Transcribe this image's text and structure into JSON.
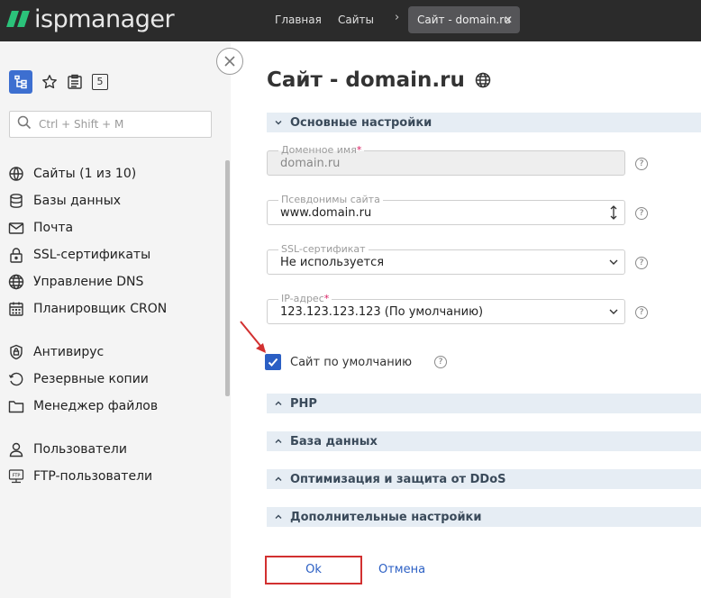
{
  "topbar": {
    "logo": "ispmanager",
    "nav_home": "Главная",
    "nav_sites": "Сайты",
    "tab_label": "Сайт - domain.ru"
  },
  "sidebar": {
    "badge_count": "5",
    "search_placeholder": "Ctrl + Shift + M",
    "items": [
      {
        "label": "Сайты (1 из 10)",
        "icon": "sites-icon"
      },
      {
        "label": "Базы данных",
        "icon": "database-icon"
      },
      {
        "label": "Почта",
        "icon": "mail-icon"
      },
      {
        "label": "SSL-сертификаты",
        "icon": "lock-icon"
      },
      {
        "label": "Управление DNS",
        "icon": "globe-icon"
      },
      {
        "label": "Планировщик CRON",
        "icon": "calendar-icon"
      },
      {
        "label": "Антивирус",
        "icon": "shield-icon"
      },
      {
        "label": "Резервные копии",
        "icon": "backup-icon"
      },
      {
        "label": "Менеджер файлов",
        "icon": "folder-icon"
      },
      {
        "label": "Пользователи",
        "icon": "user-icon"
      },
      {
        "label": "FTP-пользователи",
        "icon": "ftp-icon"
      }
    ]
  },
  "main": {
    "title": "Сайт - domain.ru",
    "sections": {
      "basic": "Основные настройки",
      "php": "PHP",
      "db": "База данных",
      "ddos": "Оптимизация и защита от DDoS",
      "extra": "Дополнительные настройки"
    },
    "fields": {
      "domain": {
        "label": "Доменное имя",
        "value": "domain.ru"
      },
      "aliases": {
        "label": "Псевдонимы сайта",
        "value": "www.domain.ru"
      },
      "ssl": {
        "label": "SSL-сертификат",
        "value": "Не используется"
      },
      "ip": {
        "label": "IP-адрес",
        "value": "123.123.123.123 (По умолчанию)"
      }
    },
    "required_mark": "*",
    "help_mark": "?",
    "default_site_label": "Сайт по умолчанию",
    "default_site_checked": true,
    "ok_label": "Ok",
    "cancel_label": "Отмена"
  },
  "colors": {
    "accent": "#2b5fc4",
    "logo_green": "#2bc27a",
    "highlight_red": "#d23030",
    "section_bg": "#e6edf4"
  }
}
